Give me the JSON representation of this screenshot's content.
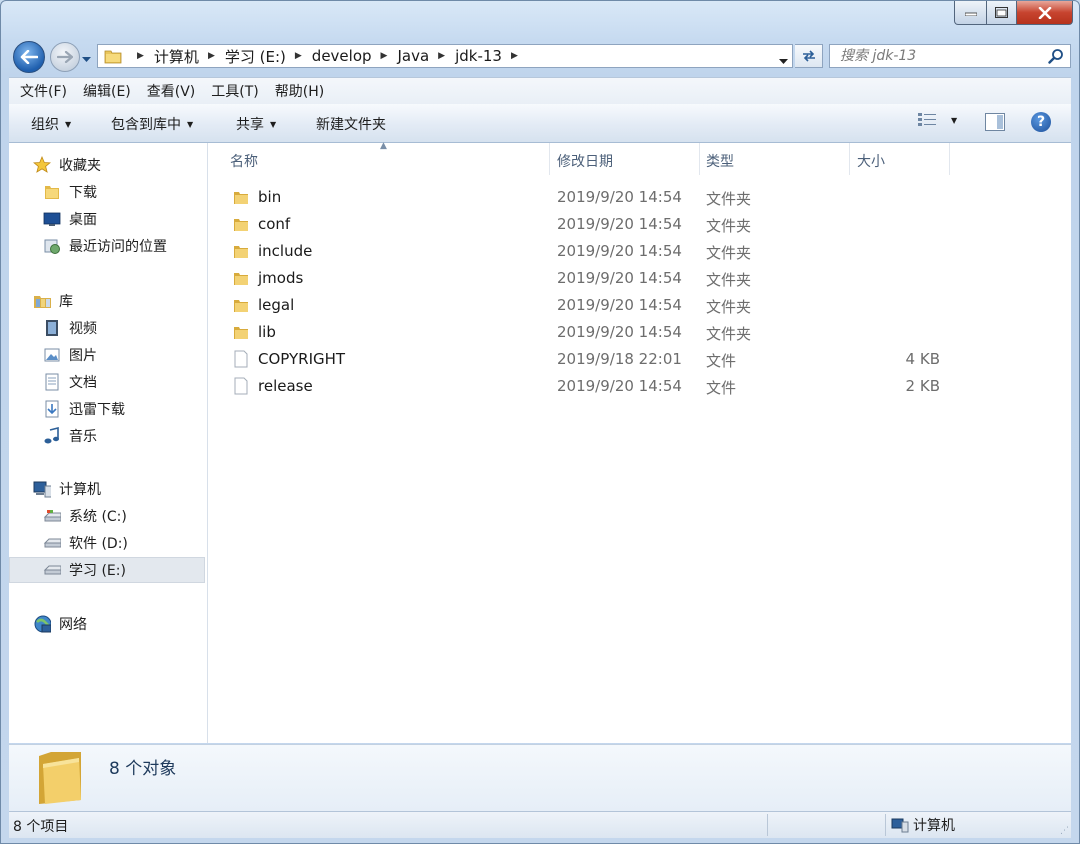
{
  "window": {
    "breadcrumbs": [
      "计算机",
      "学习 (E:)",
      "develop",
      "Java",
      "jdk-13"
    ],
    "search_placeholder": "搜索 jdk-13"
  },
  "menu": [
    "文件(F)",
    "编辑(E)",
    "查看(V)",
    "工具(T)",
    "帮助(H)"
  ],
  "toolbar": {
    "organize": "组织",
    "include_in_library": "包含到库中",
    "share": "共享",
    "new_folder": "新建文件夹"
  },
  "nav": {
    "favorites": "收藏夹",
    "downloads": "下载",
    "desktop": "桌面",
    "recent": "最近访问的位置",
    "libraries": "库",
    "videos": "视频",
    "pictures": "图片",
    "documents": "文档",
    "thunder": "迅雷下载",
    "music": "音乐",
    "computer": "计算机",
    "drive_c": "系统 (C:)",
    "drive_d": "软件 (D:)",
    "drive_e": "学习 (E:)",
    "network": "网络"
  },
  "columns": {
    "name": "名称",
    "date": "修改日期",
    "type": "类型",
    "size": "大小"
  },
  "files": [
    {
      "name": "bin",
      "date": "2019/9/20 14:54",
      "type": "文件夹",
      "size": "",
      "icon": "folder-icon"
    },
    {
      "name": "conf",
      "date": "2019/9/20 14:54",
      "type": "文件夹",
      "size": "",
      "icon": "folder-icon"
    },
    {
      "name": "include",
      "date": "2019/9/20 14:54",
      "type": "文件夹",
      "size": "",
      "icon": "folder-icon"
    },
    {
      "name": "jmods",
      "date": "2019/9/20 14:54",
      "type": "文件夹",
      "size": "",
      "icon": "folder-icon"
    },
    {
      "name": "legal",
      "date": "2019/9/20 14:54",
      "type": "文件夹",
      "size": "",
      "icon": "folder-icon"
    },
    {
      "name": "lib",
      "date": "2019/9/20 14:54",
      "type": "文件夹",
      "size": "",
      "icon": "folder-icon"
    },
    {
      "name": "COPYRIGHT",
      "date": "2019/9/18 22:01",
      "type": "文件",
      "size": "4 KB",
      "icon": "file-icon"
    },
    {
      "name": "release",
      "date": "2019/9/20 14:54",
      "type": "文件",
      "size": "2 KB",
      "icon": "file-icon"
    }
  ],
  "details": {
    "count": "8 个对象"
  },
  "status": {
    "items": "8 个项目",
    "location": "计算机"
  }
}
